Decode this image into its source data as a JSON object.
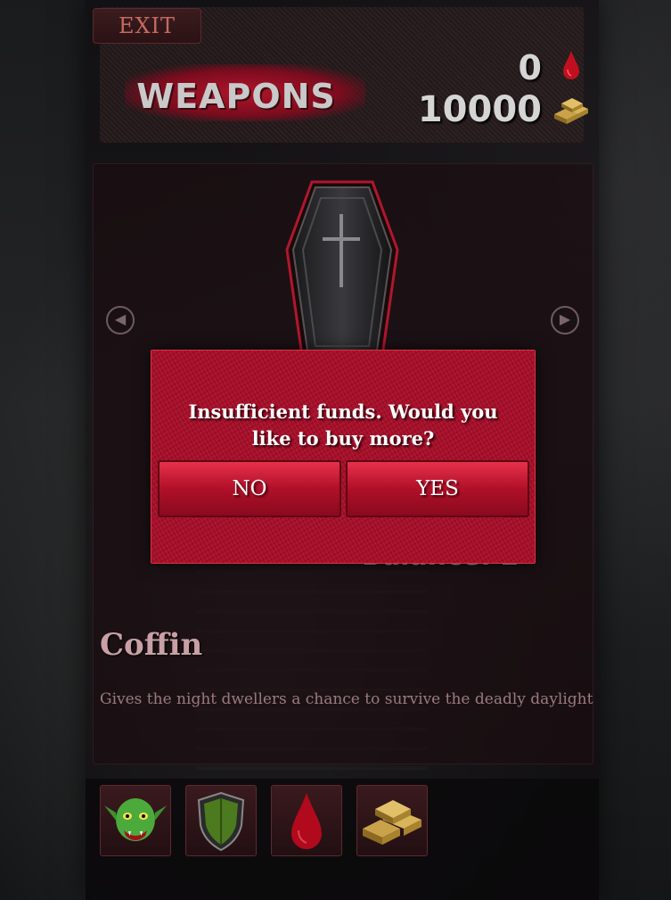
{
  "header": {
    "exit_label": "EXIT",
    "section_title": "WEAPONS",
    "blood_count": "0",
    "gold_count": "10000"
  },
  "item": {
    "name": "Coffin",
    "description": "Gives the night dwellers a chance to survive the deadly daylight",
    "balance_label": "Balance: 2"
  },
  "navigation": {
    "prev_icon": "chevron-left-icon",
    "next_icon": "chevron-right-icon"
  },
  "bottom_tabs": [
    {
      "icon": "goblin-icon"
    },
    {
      "icon": "shield-icon"
    },
    {
      "icon": "blood-drop-icon"
    },
    {
      "icon": "gold-bars-icon"
    }
  ],
  "dialog": {
    "message": "Insufficient funds. Would you like to buy more?",
    "no_label": "NO",
    "yes_label": "YES"
  },
  "colors": {
    "accent": "#a4102a",
    "button": "#b01028"
  }
}
